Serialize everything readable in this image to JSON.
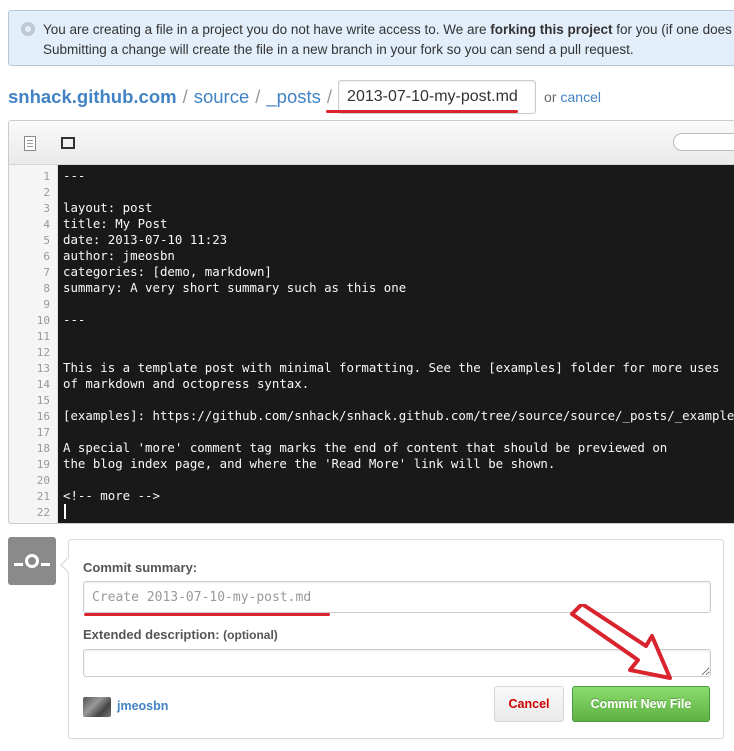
{
  "flash": {
    "icon": "octoface-icon",
    "text_start": "You are creating a file in a project you do not have write access to. We are ",
    "text_bold": "forking this project",
    "text_end": " for you (if one does not",
    "line2": "Submitting a change will create the file in a new branch in your fork so you can send a pull request."
  },
  "breadcrumb": {
    "repo": "snhack.github.com",
    "sep": "/",
    "segments": [
      "source",
      "_posts"
    ],
    "filename": "2013-07-10-my-post.md",
    "or": "or",
    "cancel": "cancel"
  },
  "editor": {
    "toolbar_icons": [
      "document-icon",
      "fullscreen-icon"
    ],
    "lines": [
      {
        "n": "1",
        "t": "---"
      },
      {
        "n": "2",
        "t": ""
      },
      {
        "n": "3",
        "t": "layout: post"
      },
      {
        "n": "4",
        "t": "title: My Post"
      },
      {
        "n": "5",
        "t": "date: 2013-07-10 11:23"
      },
      {
        "n": "6",
        "t": "author: jmeosbn"
      },
      {
        "n": "7",
        "t": "categories: [demo, markdown]"
      },
      {
        "n": "8",
        "t": "summary: A very short summary such as this one"
      },
      {
        "n": "9",
        "t": ""
      },
      {
        "n": "10",
        "t": "---"
      },
      {
        "n": "11",
        "t": ""
      },
      {
        "n": "12",
        "t": ""
      },
      {
        "n": "13",
        "t": "This is a template post with minimal formatting. See the [examples] folder for more uses"
      },
      {
        "n": "14",
        "t": "of markdown and octopress syntax."
      },
      {
        "n": "15",
        "t": ""
      },
      {
        "n": "16",
        "t": "[examples]: https://github.com/snhack/snhack.github.com/tree/source/source/_posts/_examples"
      },
      {
        "n": "17",
        "t": ""
      },
      {
        "n": "18",
        "t": "A special 'more' comment tag marks the end of content that should be previewed on"
      },
      {
        "n": "19",
        "t": "the blog index page, and where the 'Read More' link will be shown."
      },
      {
        "n": "20",
        "t": ""
      },
      {
        "n": "21",
        "t": "<!-- more -->"
      },
      {
        "n": "22",
        "t": ""
      }
    ]
  },
  "commit": {
    "icon": "commit-icon",
    "summary_label": "Commit summary:",
    "summary_placeholder": "Create 2013-07-10-my-post.md",
    "description_label": "Extended description:",
    "description_optional": "(optional)",
    "user": "jmeosbn",
    "cancel_label": "Cancel",
    "commit_label": "Commit New File"
  },
  "colors": {
    "link": "#4183c4",
    "flash_bg": "#e2eef9",
    "editor_bg": "#191919",
    "commit_green": "#60b044",
    "annotation_red": "#d9232d"
  }
}
